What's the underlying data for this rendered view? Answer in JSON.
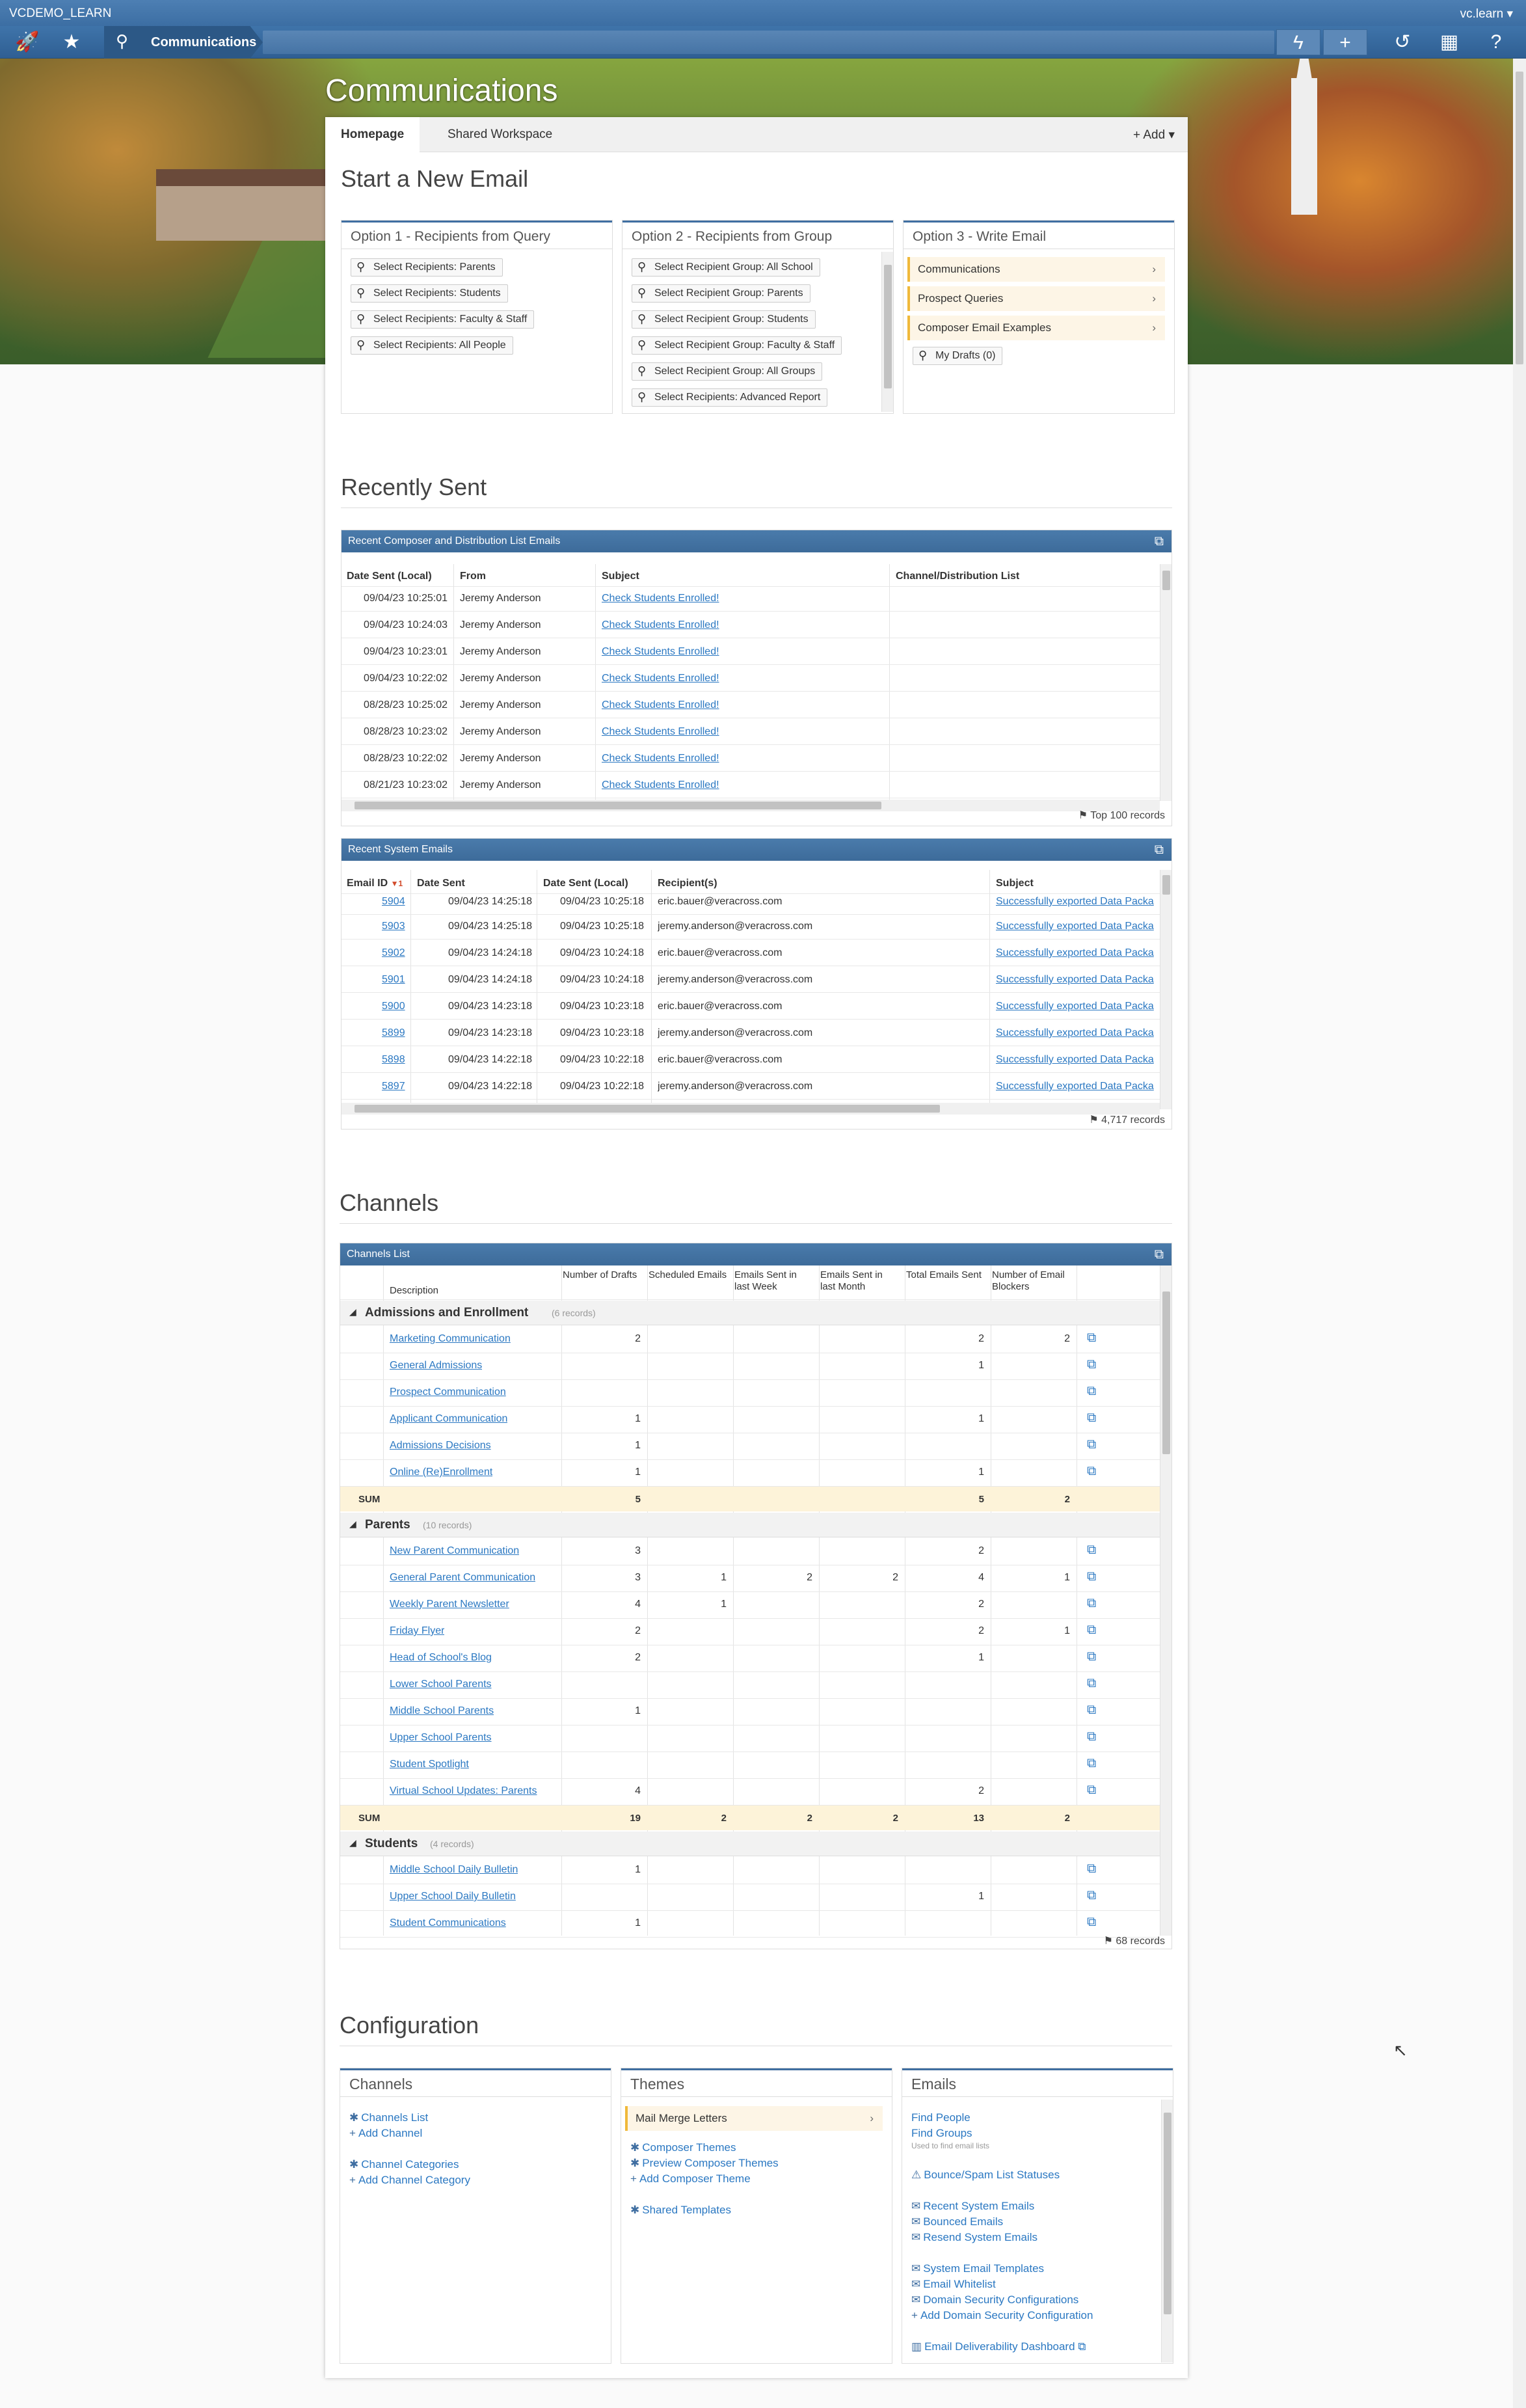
{
  "topbar": {
    "system_name": "VCDEMO_LEARN",
    "user_menu": "vc.learn ▾"
  },
  "nav": {
    "breadcrumb": "Communications"
  },
  "page_title": "Communications",
  "tabs": [
    {
      "label": "Homepage"
    },
    {
      "label": "Shared Workspace"
    }
  ],
  "add_label": "Add",
  "start_email": {
    "title": "Start a New Email",
    "option1": {
      "title": "Option 1 - Recipients from Query",
      "items": [
        "Select Recipients: Parents",
        "Select Recipients: Students",
        "Select Recipients: Faculty & Staff",
        "Select Recipients: All People"
      ]
    },
    "option2": {
      "title": "Option 2 - Recipients from Group",
      "items": [
        "Select Recipient Group: All School",
        "Select Recipient Group: Parents",
        "Select Recipient Group: Students",
        "Select Recipient Group: Faculty & Staff",
        "Select Recipient Group: All Groups",
        "Select Recipients: Advanced Report"
      ]
    },
    "option3": {
      "title": "Option 3 - Write Email",
      "items": [
        "Communications",
        "Prospect Queries",
        "Composer Email Examples"
      ],
      "drafts_label": "My Drafts",
      "drafts_count": "(0)"
    }
  },
  "recently_sent": {
    "title": "Recently Sent",
    "composer": {
      "title": "Recent Composer and Distribution List Emails",
      "columns": [
        "Date Sent (Local)",
        "From",
        "Subject",
        "Channel/Distribution List"
      ],
      "rows": [
        [
          "09/04/23 10:25:01",
          "Jeremy Anderson",
          "Check Students Enrolled!",
          ""
        ],
        [
          "09/04/23 10:24:03",
          "Jeremy Anderson",
          "Check Students Enrolled!",
          ""
        ],
        [
          "09/04/23 10:23:01",
          "Jeremy Anderson",
          "Check Students Enrolled!",
          ""
        ],
        [
          "09/04/23 10:22:02",
          "Jeremy Anderson",
          "Check Students Enrolled!",
          ""
        ],
        [
          "08/28/23 10:25:02",
          "Jeremy Anderson",
          "Check Students Enrolled!",
          ""
        ],
        [
          "08/28/23 10:23:02",
          "Jeremy Anderson",
          "Check Students Enrolled!",
          ""
        ],
        [
          "08/28/23 10:22:02",
          "Jeremy Anderson",
          "Check Students Enrolled!",
          ""
        ],
        [
          "08/21/23 10:23:02",
          "Jeremy Anderson",
          "Check Students Enrolled!",
          ""
        ]
      ],
      "records": "Top 100 records"
    },
    "system": {
      "title": "Recent System Emails",
      "columns": [
        "Email ID",
        "Date Sent",
        "Date Sent (Local)",
        "Recipient(s)",
        "Subject"
      ],
      "sort_marker": "▼1",
      "rows": [
        [
          "5904",
          "09/04/23 14:25:18",
          "09/04/23 10:25:18",
          "eric.bauer@veracross.com",
          "Successfully exported Data Packa"
        ],
        [
          "5903",
          "09/04/23 14:25:18",
          "09/04/23 10:25:18",
          "jeremy.anderson@veracross.com",
          "Successfully exported Data Packa"
        ],
        [
          "5902",
          "09/04/23 14:24:18",
          "09/04/23 10:24:18",
          "eric.bauer@veracross.com",
          "Successfully exported Data Packa"
        ],
        [
          "5901",
          "09/04/23 14:24:18",
          "09/04/23 10:24:18",
          "jeremy.anderson@veracross.com",
          "Successfully exported Data Packa"
        ],
        [
          "5900",
          "09/04/23 14:23:18",
          "09/04/23 10:23:18",
          "eric.bauer@veracross.com",
          "Successfully exported Data Packa"
        ],
        [
          "5899",
          "09/04/23 14:23:18",
          "09/04/23 10:23:18",
          "jeremy.anderson@veracross.com",
          "Successfully exported Data Packa"
        ],
        [
          "5898",
          "09/04/23 14:22:18",
          "09/04/23 10:22:18",
          "eric.bauer@veracross.com",
          "Successfully exported Data Packa"
        ],
        [
          "5897",
          "09/04/23 14:22:18",
          "09/04/23 10:22:18",
          "jeremy.anderson@veracross.com",
          "Successfully exported Data Packa"
        ]
      ],
      "records": "4,717 records"
    }
  },
  "channels": {
    "title": "Channels",
    "grid_title": "Channels List",
    "columns": [
      "Description",
      "Number of Drafts",
      "Scheduled Emails",
      "Emails Sent in last Week",
      "Emails Sent in last Month",
      "Total Emails Sent",
      "Number of Email Blockers"
    ],
    "sum_label": "SUM",
    "groups": [
      {
        "name": "Admissions and Enrollment",
        "count": "(6 records)",
        "rows": [
          [
            "Marketing Communication",
            "2",
            "",
            "",
            "",
            "2",
            "2"
          ],
          [
            "General Admissions",
            "",
            "",
            "",
            "",
            "1",
            ""
          ],
          [
            "Prospect Communication",
            "",
            "",
            "",
            "",
            "",
            ""
          ],
          [
            "Applicant Communication",
            "1",
            "",
            "",
            "",
            "1",
            ""
          ],
          [
            "Admissions Decisions",
            "1",
            "",
            "",
            "",
            "",
            ""
          ],
          [
            "Online (Re)Enrollment",
            "1",
            "",
            "",
            "",
            "1",
            ""
          ]
        ],
        "sum": [
          "5",
          "",
          "",
          "",
          "5",
          "2"
        ]
      },
      {
        "name": "Parents",
        "count": "(10 records)",
        "rows": [
          [
            "New Parent Communication",
            "3",
            "",
            "",
            "",
            "2",
            ""
          ],
          [
            "General Parent Communication",
            "3",
            "1",
            "2",
            "2",
            "4",
            "1"
          ],
          [
            "Weekly Parent Newsletter",
            "4",
            "1",
            "",
            "",
            "2",
            ""
          ],
          [
            "Friday Flyer",
            "2",
            "",
            "",
            "",
            "2",
            "1"
          ],
          [
            "Head of School's Blog",
            "2",
            "",
            "",
            "",
            "1",
            ""
          ],
          [
            "Lower School Parents",
            "",
            "",
            "",
            "",
            "",
            ""
          ],
          [
            "Middle School Parents",
            "1",
            "",
            "",
            "",
            "",
            ""
          ],
          [
            "Upper School Parents",
            "",
            "",
            "",
            "",
            "",
            ""
          ],
          [
            "Student Spotlight",
            "",
            "",
            "",
            "",
            "",
            ""
          ],
          [
            "Virtual School Updates: Parents",
            "4",
            "",
            "",
            "",
            "2",
            ""
          ]
        ],
        "sum": [
          "19",
          "2",
          "2",
          "2",
          "13",
          "2"
        ]
      },
      {
        "name": "Students",
        "count": "(4 records)",
        "rows": [
          [
            "Middle School Daily Bulletin",
            "1",
            "",
            "",
            "",
            "",
            ""
          ],
          [
            "Upper School Daily Bulletin",
            "",
            "",
            "",
            "",
            "1",
            ""
          ],
          [
            "Student Communications",
            "1",
            "",
            "",
            "",
            "",
            ""
          ]
        ]
      }
    ],
    "records": "68 records"
  },
  "configuration": {
    "title": "Configuration",
    "channels": {
      "title": "Channels",
      "links": [
        "Channels List",
        "Add Channel",
        "Channel Categories",
        "Add Channel Category"
      ]
    },
    "themes": {
      "title": "Themes",
      "highlight": "Mail Merge Letters",
      "links": [
        "Composer Themes",
        "Preview Composer Themes",
        "Add Composer Theme",
        "Shared Templates"
      ]
    },
    "emails": {
      "title": "Emails",
      "links": [
        "Find People",
        "Find Groups"
      ],
      "hint": "Used to find email lists",
      "links2": [
        "Bounce/Spam List Statuses",
        "Recent System Emails",
        "Bounced Emails",
        "Resend System Emails",
        "System Email Templates",
        "Email Whitelist",
        "Domain Security Configurations",
        "Add Domain Security Configuration",
        "Email Deliverability Dashboard"
      ]
    }
  }
}
